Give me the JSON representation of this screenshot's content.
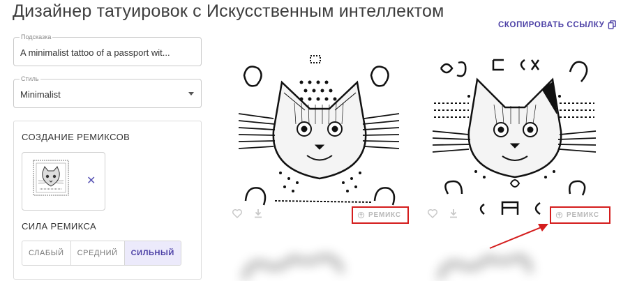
{
  "header": {
    "title": "Дизайнер татуировок с Искусственным интеллектом",
    "copy_link_label": "СКОПИРОВАТЬ ССЫЛКУ",
    "copy_icon": "copy-icon"
  },
  "form": {
    "prompt": {
      "label": "Подсказка",
      "value": "A minimalist tattoo of a passport wit..."
    },
    "style": {
      "label": "Стиль",
      "value": "Minimalist",
      "icon": "caret-down-icon"
    }
  },
  "remix": {
    "title": "СОЗДАНИЕ РЕМИКСОВ",
    "remove_label": "✕",
    "strength_title": "СИЛА РЕМИКСА",
    "strength_options": [
      "СЛАБЫЙ",
      "СРЕДНИЙ",
      "СИЛЬНЫЙ"
    ],
    "strength_selected": "СИЛЬНЫЙ"
  },
  "results": [
    {
      "remix_label": "РЕМИКС",
      "icons": [
        "heart-icon",
        "download-icon",
        "remix-icon"
      ]
    },
    {
      "remix_label": "РЕМИКС",
      "icons": [
        "heart-icon",
        "download-icon",
        "remix-icon"
      ]
    }
  ],
  "annotation": {
    "color": "#d41d1d"
  },
  "colors": {
    "accent": "#4b3fa5",
    "highlight": "#d41d1d"
  }
}
